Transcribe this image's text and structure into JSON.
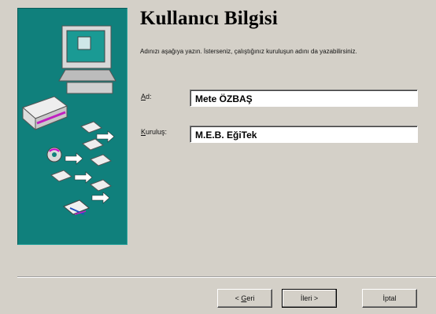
{
  "wizard": {
    "title": "Kullanıcı Bilgisi",
    "description": "Adınızı aşağıya yazın. İsterseniz, çalıştığınız kuruluşun adını da yazabilirsiniz."
  },
  "fields": {
    "name": {
      "label_accel": "A",
      "label_rest": "d:",
      "value": "Mete ÖZBAŞ"
    },
    "org": {
      "label_accel": "K",
      "label_rest": "uruluş:",
      "value": "M.E.B. EğiTek"
    }
  },
  "buttons": {
    "back_prefix": "< ",
    "back_accel": "G",
    "back_rest": "eri",
    "next": "İleri >",
    "cancel": "İptal"
  },
  "colors": {
    "panel": "#10807c",
    "dialog": "#d4d0c8"
  },
  "icons": [
    "computer-icon",
    "cd-icon",
    "floppy-icon",
    "network-icon"
  ]
}
